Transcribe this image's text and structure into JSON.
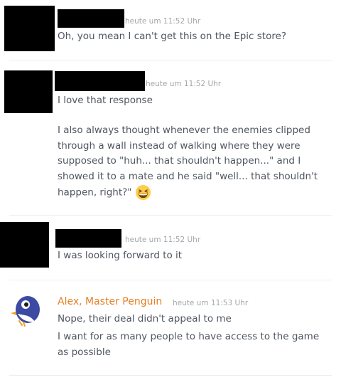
{
  "messages": [
    {
      "timestamp": "heute um 11:52 Uhr",
      "lines": [
        "Oh, you mean I can't get this on the Epic store?"
      ]
    },
    {
      "timestamp": "heute um 11:52 Uhr",
      "lines": [
        "I love that response",
        "I also always thought whenever the enemies clipped through a wall instead of walking where they were supposed to \"huh... that shouldn't happen...\" and I showed it to a mate and he said \"well... that shouldn't happen, right?\""
      ],
      "emoji": "grinning-squinting-face"
    },
    {
      "timestamp": "heute um 11:52 Uhr",
      "lines": [
        "I was looking forward to it"
      ]
    },
    {
      "author": "Alex, Master Penguin",
      "author_color": "#e67e22",
      "timestamp": "heute um 11:53 Uhr",
      "lines": [
        "Nope, their deal didn't appeal to me",
        "I want for as many people to have access to the game as possible"
      ]
    }
  ]
}
